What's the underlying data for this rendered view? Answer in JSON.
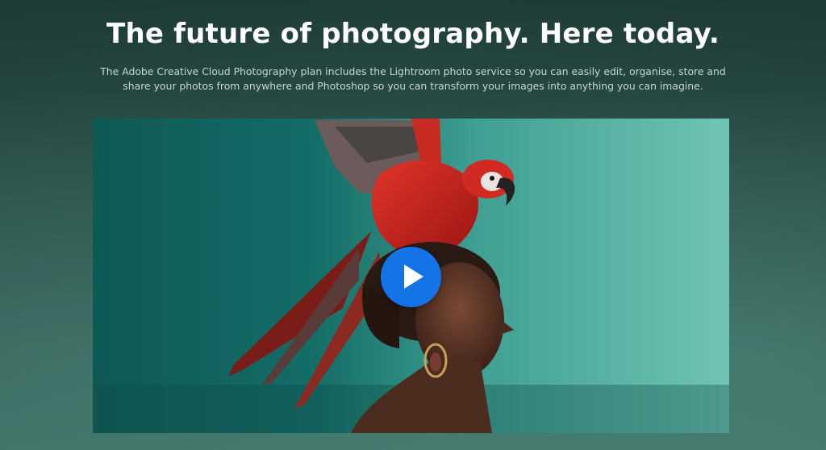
{
  "hero": {
    "headline": "The future of photography. Here today.",
    "description": "The Adobe Creative Cloud Photography plan includes the Lightroom photo service so you can easily edit, organise, store and share your photos from anywhere and Photoshop so you can transform your images into anything you can imagine."
  },
  "video": {
    "play_icon": "play-icon",
    "image_subject": "macaw-on-woman-head-photo"
  },
  "colors": {
    "headline": "#ffffff",
    "description": "#c7d6d2",
    "play_button": "#1473e6",
    "macaw_red": "#c8201b",
    "background_teal": "#2f5650"
  }
}
